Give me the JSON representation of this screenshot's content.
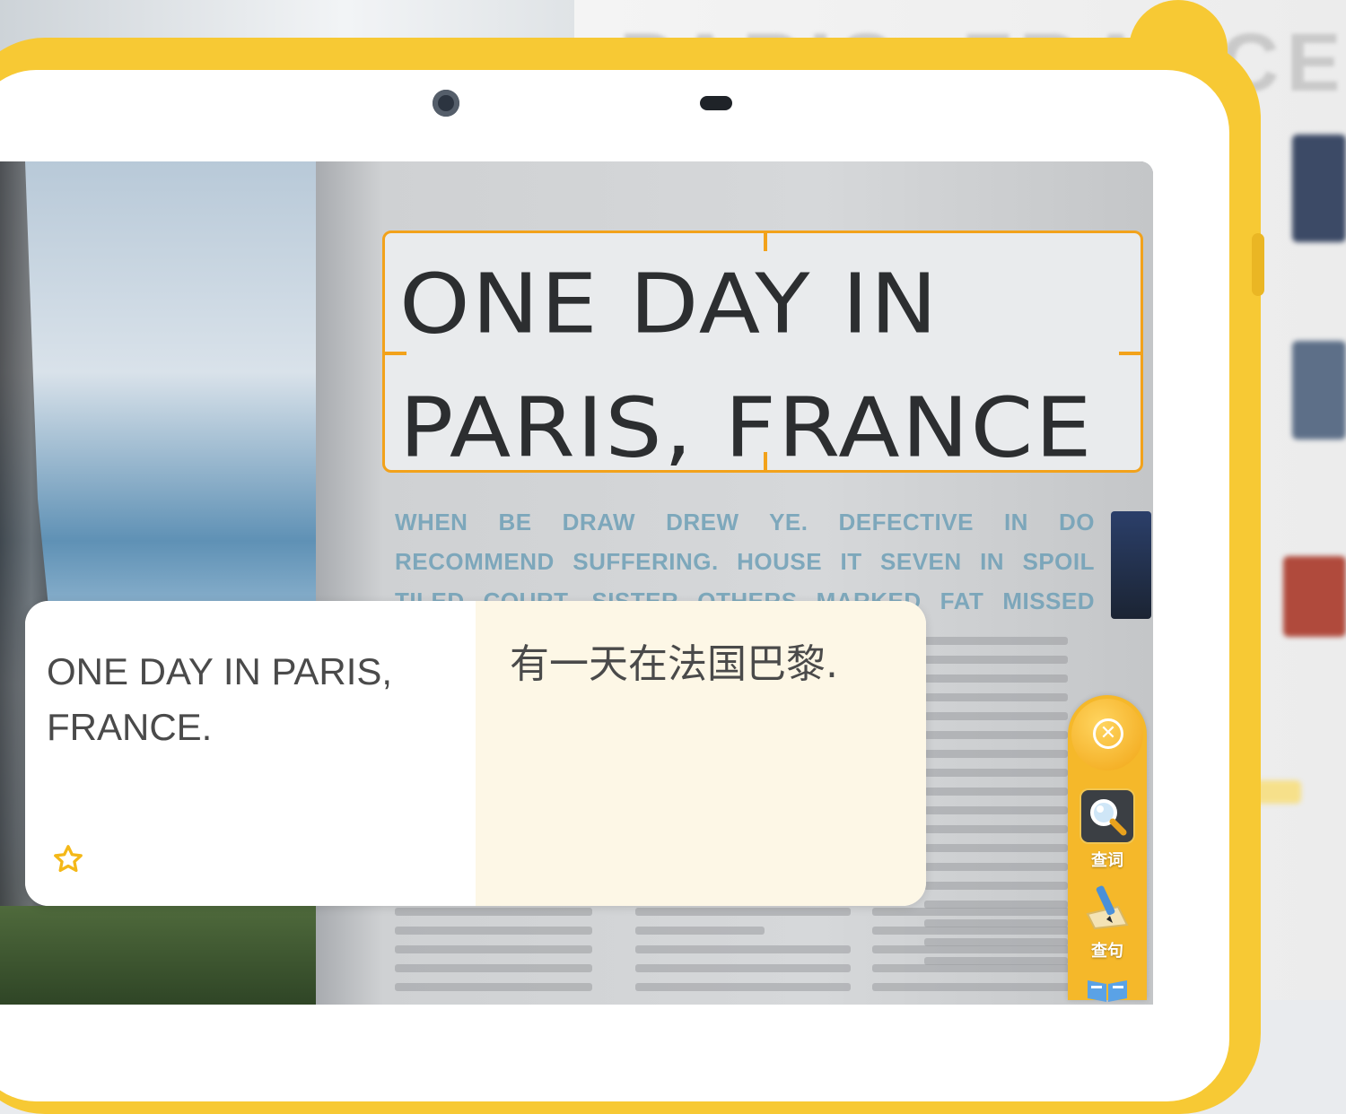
{
  "background": {
    "headline": "PARIS, FRANCE"
  },
  "scan": {
    "captured_text_line1": "ONE DAY IN",
    "captured_text_line2": "PARIS, FRANCE"
  },
  "page_body_text": [
    "WHEN BE DRAW DREW YE. DEFECTIVE IN DO",
    "RECOMMEND SUFFERING. HOUSE IT SEVEN IN SPOIL",
    "TILED COURT. SISTER OTHERS MARKED FAT MISSED"
  ],
  "result": {
    "source": "ONE DAY IN PARIS, FRANCE.",
    "translation": "有一天在法国巴黎."
  },
  "toolbar": {
    "lookup_word_label": "查词",
    "lookup_sentence_label": "查句"
  },
  "colors": {
    "accent": "#f2a21b",
    "bumper": "#f7c934",
    "card_translation_bg": "#fdf7e6"
  },
  "icons": {
    "close": "close-circle-icon",
    "search": "magnifier-icon",
    "sentence": "pen-paper-icon",
    "favorite": "star-outline-icon",
    "book": "open-book-icon"
  }
}
